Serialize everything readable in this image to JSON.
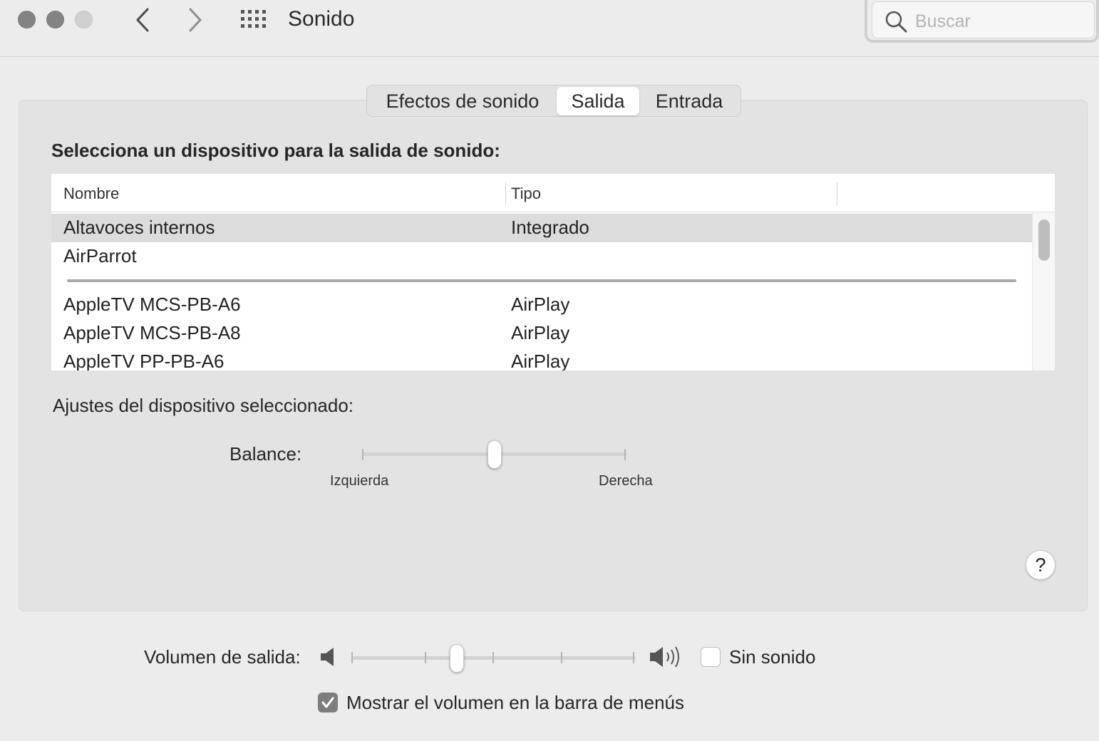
{
  "window": {
    "title": "Sonido",
    "search_placeholder": "Buscar"
  },
  "icons": {
    "back": "chevron-left-icon",
    "forward": "chevron-right-icon",
    "grid": "grid-icon",
    "search": "search-icon",
    "volume_low": "speaker-low-icon",
    "volume_high": "speaker-high-icon",
    "checkmark": "checkmark-icon"
  },
  "tabs": [
    {
      "label": "Efectos de sonido",
      "selected": false
    },
    {
      "label": "Salida",
      "selected": true
    },
    {
      "label": "Entrada",
      "selected": false
    }
  ],
  "output": {
    "heading": "Selecciona un dispositivo para la salida de sonido:",
    "columns": {
      "name": "Nombre",
      "type": "Tipo"
    },
    "devices": [
      {
        "name": "Altavoces internos",
        "type": "Integrado",
        "selected": true
      },
      {
        "name": "AirParrot",
        "type": "",
        "selected": false
      },
      {
        "name": "AppleTV MCS-PB-A6",
        "type": "AirPlay",
        "selected": false
      },
      {
        "name": "AppleTV MCS-PB-A8",
        "type": "AirPlay",
        "selected": false
      },
      {
        "name": "AppleTV PP-PB-A6",
        "type": "AirPlay",
        "selected": false
      }
    ]
  },
  "device_settings": {
    "heading": "Ajustes del dispositivo seleccionado:",
    "balance_label": "Balance:",
    "balance_left": "Izquierda",
    "balance_right": "Derecha",
    "balance_value": 0.5
  },
  "help_label": "?",
  "volume": {
    "label": "Volumen de salida:",
    "value": 0.37,
    "mute_label": "Sin sonido",
    "mute_checked": false,
    "show_in_menubar_label": "Mostrar el volumen en la barra de menús",
    "show_in_menubar_checked": true
  },
  "colors": {
    "panel": "#e3e3e3",
    "window": "#ececec",
    "selected_row": "#dcdcdc",
    "checkbox_checked": "#7d7d7d"
  }
}
